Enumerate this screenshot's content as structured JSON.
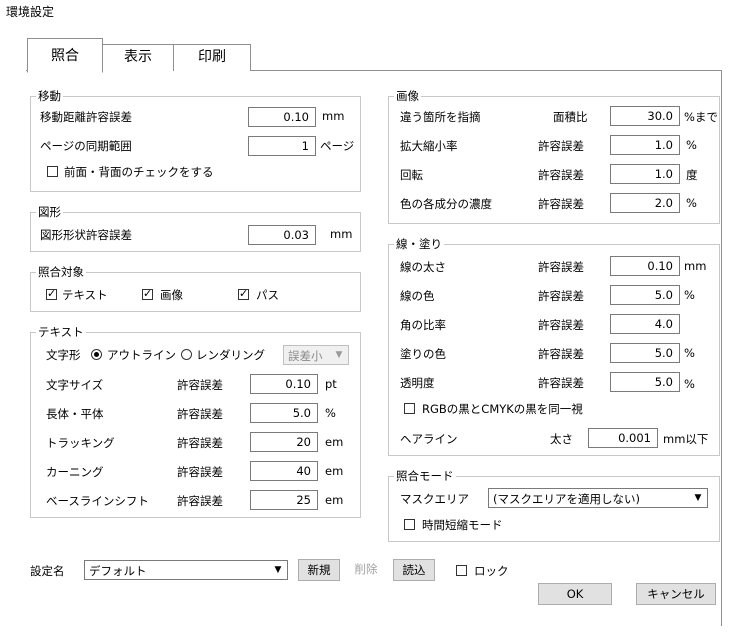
{
  "window": {
    "title": "環境設定"
  },
  "tabs": [
    {
      "label": "照合",
      "selected": true
    },
    {
      "label": "表示"
    },
    {
      "label": "印刷"
    }
  ],
  "move_group": {
    "label": "移動",
    "tolerance_label": "移動距離許容誤差",
    "tolerance_value": "0.10",
    "tolerance_unit": "mm",
    "page_sync_label": "ページの同期範囲",
    "page_sync_value": "1",
    "page_sync_unit": "ページ",
    "front_back_label": "前面・背面のチェックをする",
    "front_back_checked": false
  },
  "shape_group": {
    "label": "図形",
    "tolerance_label": "図形形状許容誤差",
    "tolerance_value": "0.03",
    "tolerance_unit": "mm"
  },
  "target_group": {
    "label": "照合対象",
    "text_label": "テキスト",
    "image_label": "画像",
    "path_label": "パス"
  },
  "text_group": {
    "label": "テキスト",
    "shape_label": "文字形",
    "outline_label": "アウトライン",
    "rendering_label": "レンダリング",
    "rendering_option": "誤差小",
    "tolerance_word": "許容誤差",
    "rows": [
      {
        "label": "文字サイズ",
        "value": "0.10",
        "unit": "pt"
      },
      {
        "label": "長体・平体",
        "value": "5.0",
        "unit": "%"
      },
      {
        "label": "トラッキング",
        "value": "20",
        "unit": "em"
      },
      {
        "label": "カーニング",
        "value": "40",
        "unit": "em"
      },
      {
        "label": "ベースラインシフト",
        "value": "25",
        "unit": "em"
      }
    ]
  },
  "image_group": {
    "label": "画像",
    "rows": [
      {
        "label": "違う箇所を指摘",
        "sub": "面積比",
        "value": "30.0",
        "unit": "%まで"
      },
      {
        "label": "拡大縮小率",
        "sub": "許容誤差",
        "value": "1.0",
        "unit": "%"
      },
      {
        "label": "回転",
        "sub": "許容誤差",
        "value": "1.0",
        "unit": "度"
      },
      {
        "label": "色の各成分の濃度",
        "sub": "許容誤差",
        "value": "2.0",
        "unit": "%"
      }
    ]
  },
  "line_group": {
    "label": "線・塗り",
    "rows": [
      {
        "label": "線の太さ",
        "sub": "許容誤差",
        "value": "0.10",
        "unit": "mm"
      },
      {
        "label": "線の色",
        "sub": "許容誤差",
        "value": "5.0",
        "unit": "%"
      },
      {
        "label": "角の比率",
        "sub": "許容誤差",
        "value": "4.0",
        "unit": ""
      },
      {
        "label": "塗りの色",
        "sub": "許容誤差",
        "value": "5.0",
        "unit": "%"
      },
      {
        "label": "透明度",
        "sub": "許容誤差",
        "value": "5.0",
        "unit": "%"
      }
    ],
    "rgb_cmyk_label": "RGBの黒とCMYKの黒を同一視",
    "hairline_label": "ヘアライン",
    "hairline_sub": "太さ",
    "hairline_value": "0.001",
    "hairline_unit": "mm以下"
  },
  "mode_group": {
    "label": "照合モード",
    "mask_label": "マスクエリア",
    "mask_value": "(マスクエリアを適用しない)",
    "fast_label": "時間短縮モード"
  },
  "footer": {
    "setting_name_label": "設定名",
    "setting_name_value": "デフォルト",
    "new_label": "新規",
    "delete_label": "削除",
    "load_label": "読込",
    "lock_label": "ロック",
    "ok_label": "OK",
    "cancel_label": "キャンセル"
  }
}
